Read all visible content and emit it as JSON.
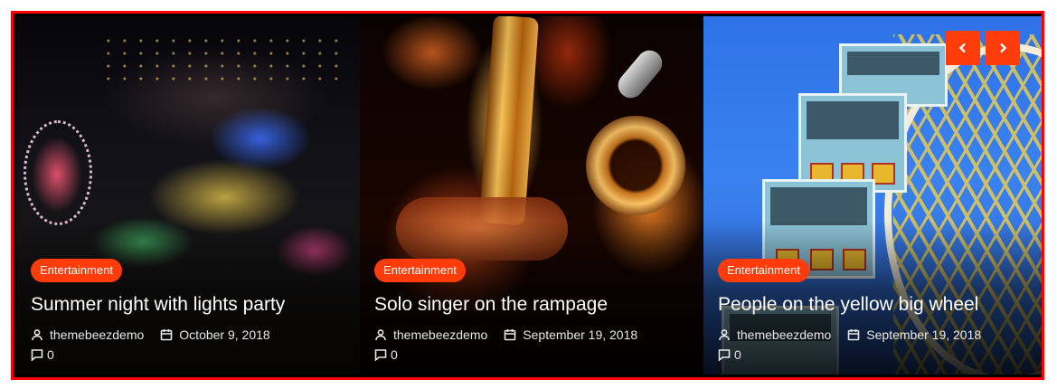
{
  "slider": {
    "slides": [
      {
        "category": "Entertainment",
        "title": "Summer night with lights party",
        "author": "themebeezdemo",
        "date": "October 9, 2018",
        "comments": "0"
      },
      {
        "category": "Entertainment",
        "title": "Solo singer on the rampage",
        "author": "themebeezdemo",
        "date": "September 19, 2018",
        "comments": "0"
      },
      {
        "category": "Entertainment",
        "title": "People on the yellow big wheel",
        "author": "themebeezdemo",
        "date": "September 19, 2018",
        "comments": "0"
      }
    ],
    "nav": {
      "prev_icon": "chevron-left-icon",
      "next_icon": "chevron-right-icon"
    }
  },
  "colors": {
    "accent": "#ff3c0a",
    "frame_border": "#ff0000"
  }
}
